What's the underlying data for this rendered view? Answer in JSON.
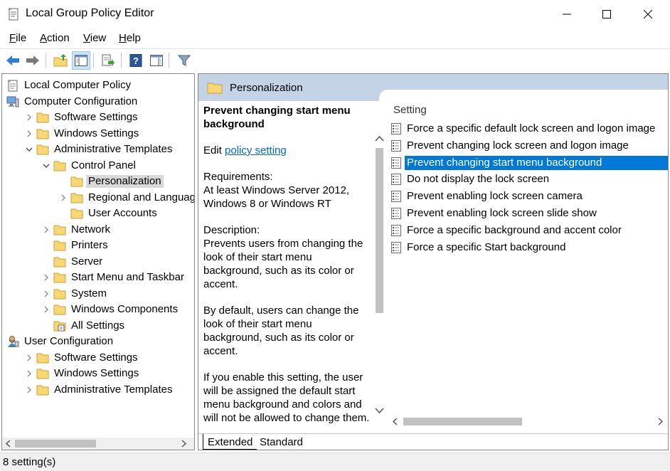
{
  "window": {
    "title": "Local Group Policy Editor"
  },
  "menu": [
    {
      "label": "File",
      "u": "F",
      "rest": "ile"
    },
    {
      "label": "Action",
      "u": "A",
      "rest": "ction"
    },
    {
      "label": "View",
      "u": "V",
      "rest": "iew"
    },
    {
      "label": "Help",
      "u": "H",
      "rest": "elp"
    }
  ],
  "tree": {
    "items": [
      {
        "label": "Local Computer Policy",
        "level": 0,
        "twisty": "none",
        "icon": "policy-doc-icon"
      },
      {
        "label": "Computer Configuration",
        "level": 0,
        "twisty": "open",
        "icon": "computer-icon"
      },
      {
        "label": "Software Settings",
        "level": 1,
        "twisty": "closed",
        "icon": "folder-icon"
      },
      {
        "label": "Windows Settings",
        "level": 1,
        "twisty": "closed",
        "icon": "folder-icon"
      },
      {
        "label": "Administrative Templates",
        "level": 1,
        "twisty": "open",
        "icon": "folder-icon"
      },
      {
        "label": "Control Panel",
        "level": 2,
        "twisty": "open",
        "icon": "folder-icon"
      },
      {
        "label": "Personalization",
        "level": 3,
        "twisty": "none",
        "icon": "folder-icon",
        "selected": true
      },
      {
        "label": "Regional and Language",
        "level": 3,
        "twisty": "closed",
        "icon": "folder-icon"
      },
      {
        "label": "User Accounts",
        "level": 3,
        "twisty": "none",
        "icon": "folder-icon"
      },
      {
        "label": "Network",
        "level": 2,
        "twisty": "closed",
        "icon": "folder-icon"
      },
      {
        "label": "Printers",
        "level": 2,
        "twisty": "none",
        "icon": "folder-icon"
      },
      {
        "label": "Server",
        "level": 2,
        "twisty": "none",
        "icon": "folder-icon"
      },
      {
        "label": "Start Menu and Taskbar",
        "level": 2,
        "twisty": "closed",
        "icon": "folder-icon"
      },
      {
        "label": "System",
        "level": 2,
        "twisty": "closed",
        "icon": "folder-icon"
      },
      {
        "label": "Windows Components",
        "level": 2,
        "twisty": "closed",
        "icon": "folder-icon"
      },
      {
        "label": "All Settings",
        "level": 2,
        "twisty": "none",
        "icon": "all-settings-icon"
      },
      {
        "label": "User Configuration",
        "level": 0,
        "twisty": "open",
        "icon": "user-icon"
      },
      {
        "label": "Software Settings",
        "level": 1,
        "twisty": "closed",
        "icon": "folder-icon"
      },
      {
        "label": "Windows Settings",
        "level": 1,
        "twisty": "closed",
        "icon": "folder-icon"
      },
      {
        "label": "Administrative Templates",
        "level": 1,
        "twisty": "closed",
        "icon": "folder-icon"
      }
    ]
  },
  "details": {
    "header_title": "Personalization",
    "setting_title": "Prevent changing start menu background",
    "edit_prefix": "Edit ",
    "edit_link": "policy setting",
    "requirements_label": "Requirements:",
    "requirements_text": "At least Windows Server 2012, Windows 8 or Windows RT",
    "description_label": "Description:",
    "description_p1": "Prevents users from changing the look of their start menu background, such as its color or accent.",
    "description_p2": "By default, users can change the look of their start menu background, such as its color or accent.",
    "description_p3": "If you enable this setting, the user will be assigned the default start menu background and colors and will not be allowed to change them."
  },
  "list": {
    "column_header": "Setting",
    "items": [
      {
        "label": "Force a specific default lock screen and logon image",
        "selected": false
      },
      {
        "label": "Prevent changing lock screen and logon image",
        "selected": false
      },
      {
        "label": "Prevent changing start menu background",
        "selected": true
      },
      {
        "label": "Do not display the lock screen",
        "selected": false
      },
      {
        "label": "Prevent enabling lock screen camera",
        "selected": false
      },
      {
        "label": "Prevent enabling lock screen slide show",
        "selected": false
      },
      {
        "label": "Force a specific background and accent color",
        "selected": false
      },
      {
        "label": "Force a specific Start background",
        "selected": false
      }
    ]
  },
  "tabs": [
    {
      "label": "Extended",
      "active": true
    },
    {
      "label": "Standard",
      "active": false
    }
  ],
  "status": {
    "text": "8 setting(s)"
  },
  "colors": {
    "selection": "#0078d7",
    "header_band": "#c4d3e6",
    "folder": "#f8d775",
    "link": "#0066cc"
  }
}
